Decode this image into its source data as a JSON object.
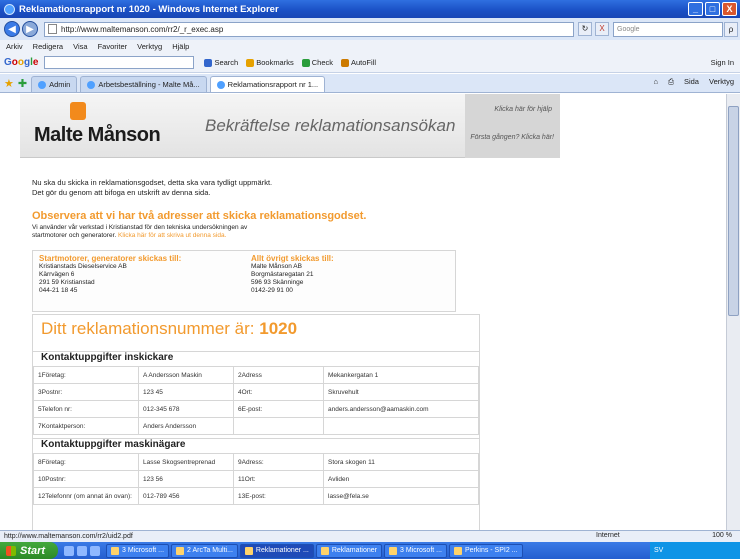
{
  "window": {
    "title": "Reklamationsrapport nr 1020 - Windows Internet Explorer",
    "min": "_",
    "max": "□",
    "close": "X"
  },
  "address": {
    "url": "http://www.maltemanson.com/rr2/_r_exec.asp",
    "search_placeholder": "Google",
    "refresh": "↻",
    "stop": "X",
    "go": "ρ"
  },
  "menu": [
    "Arkiv",
    "Redigera",
    "Visa",
    "Favoriter",
    "Verktyg",
    "Hjälp"
  ],
  "google_toolbar": {
    "logo": [
      "G",
      "o",
      "o",
      "g",
      "l",
      "e"
    ],
    "items": [
      "Search",
      "Bookmarks",
      "Check",
      "AutoFill"
    ],
    "signin": "Sign In"
  },
  "tabs": {
    "items": [
      {
        "label": "Admin"
      },
      {
        "label": "Arbetsbeställning - Malte Må..."
      },
      {
        "label": "Reklamationsrapport nr 1..."
      }
    ],
    "tools": [
      "Sida",
      "Verktyg"
    ]
  },
  "site": {
    "logo": "Malte Månson",
    "header_title": "Bekräftelse reklamationsansökan",
    "help_link": "Klicka här för hjälp",
    "first_time": "Första gången? Klicka här!",
    "intro_line1": "Nu ska du skicka in reklamationsgodset, detta ska vara tydligt uppmärkt.",
    "intro_line2": "Det gör du genom att bifoga en utskrift av denna sida.",
    "notice_title": "Observera att vi har två adresser att skicka reklamationsgodset.",
    "notice_line1": "Vi använder vår verkstad i Kristianstad för den tekniska undersökningen av",
    "notice_line2": "startmotorer och generatorer.",
    "notice_link": "Klicka här för att skriva ut denna sida.",
    "addr1": {
      "heading": "Startmotorer, generatorer skickas till:",
      "lines": [
        "Kristianstads Dieselservice AB",
        "Kärrvägen 6",
        "291 59 Kristianstad",
        "044-21 18 45"
      ]
    },
    "addr2": {
      "heading": "Allt övrigt skickas till:",
      "lines": [
        "Malte Månson AB",
        "Borgmästaregatan 21",
        "596 93 Skänninge",
        "0142-29 91 00"
      ]
    },
    "case_label": "Ditt reklamationsnummer är:",
    "case_number": "1020",
    "sender_heading": "Kontaktuppgifter inskickare",
    "sender_rows": [
      [
        "1Företag:",
        "A Andersson Maskin",
        "2Adress",
        "Mekankergatan 1"
      ],
      [
        "3Postnr:",
        "123 45",
        "4Ort:",
        "Skruvehult"
      ],
      [
        "5Telefon nr:",
        "012-345 678",
        "6E-post:",
        "anders.andersson@aamaskin.com"
      ],
      [
        "7Kontaktperson:",
        "Anders Andersson",
        "",
        ""
      ]
    ],
    "owner_heading": "Kontaktuppgifter maskinägare",
    "owner_rows": [
      [
        "8Företag:",
        "Lasse Skogsentreprenad",
        "9Adress:",
        "Stora skogen 11"
      ],
      [
        "10Postnr:",
        "123 56",
        "11Ort:",
        "Avliden"
      ],
      [
        "12Telefonnr (om annat än ovan):",
        "012-789 456",
        "13E-post:",
        "lasse@fela.se"
      ]
    ]
  },
  "status": {
    "url": "http://www.maltemanson.com/rr2/uid2.pdf",
    "zone": "Internet",
    "zoom": "100 %"
  },
  "taskbar": {
    "start": "Start",
    "items": [
      "3 Microsoft ...",
      "2 ArcTa Multi...",
      "Reklamationer ...",
      "Reklamationer",
      "3 Microsoft ...",
      "Perkins - SPI2 ..."
    ],
    "tray": "SV"
  },
  "colors": {
    "accent": "#f29a2e",
    "titlebar": "#1a4fc4"
  }
}
